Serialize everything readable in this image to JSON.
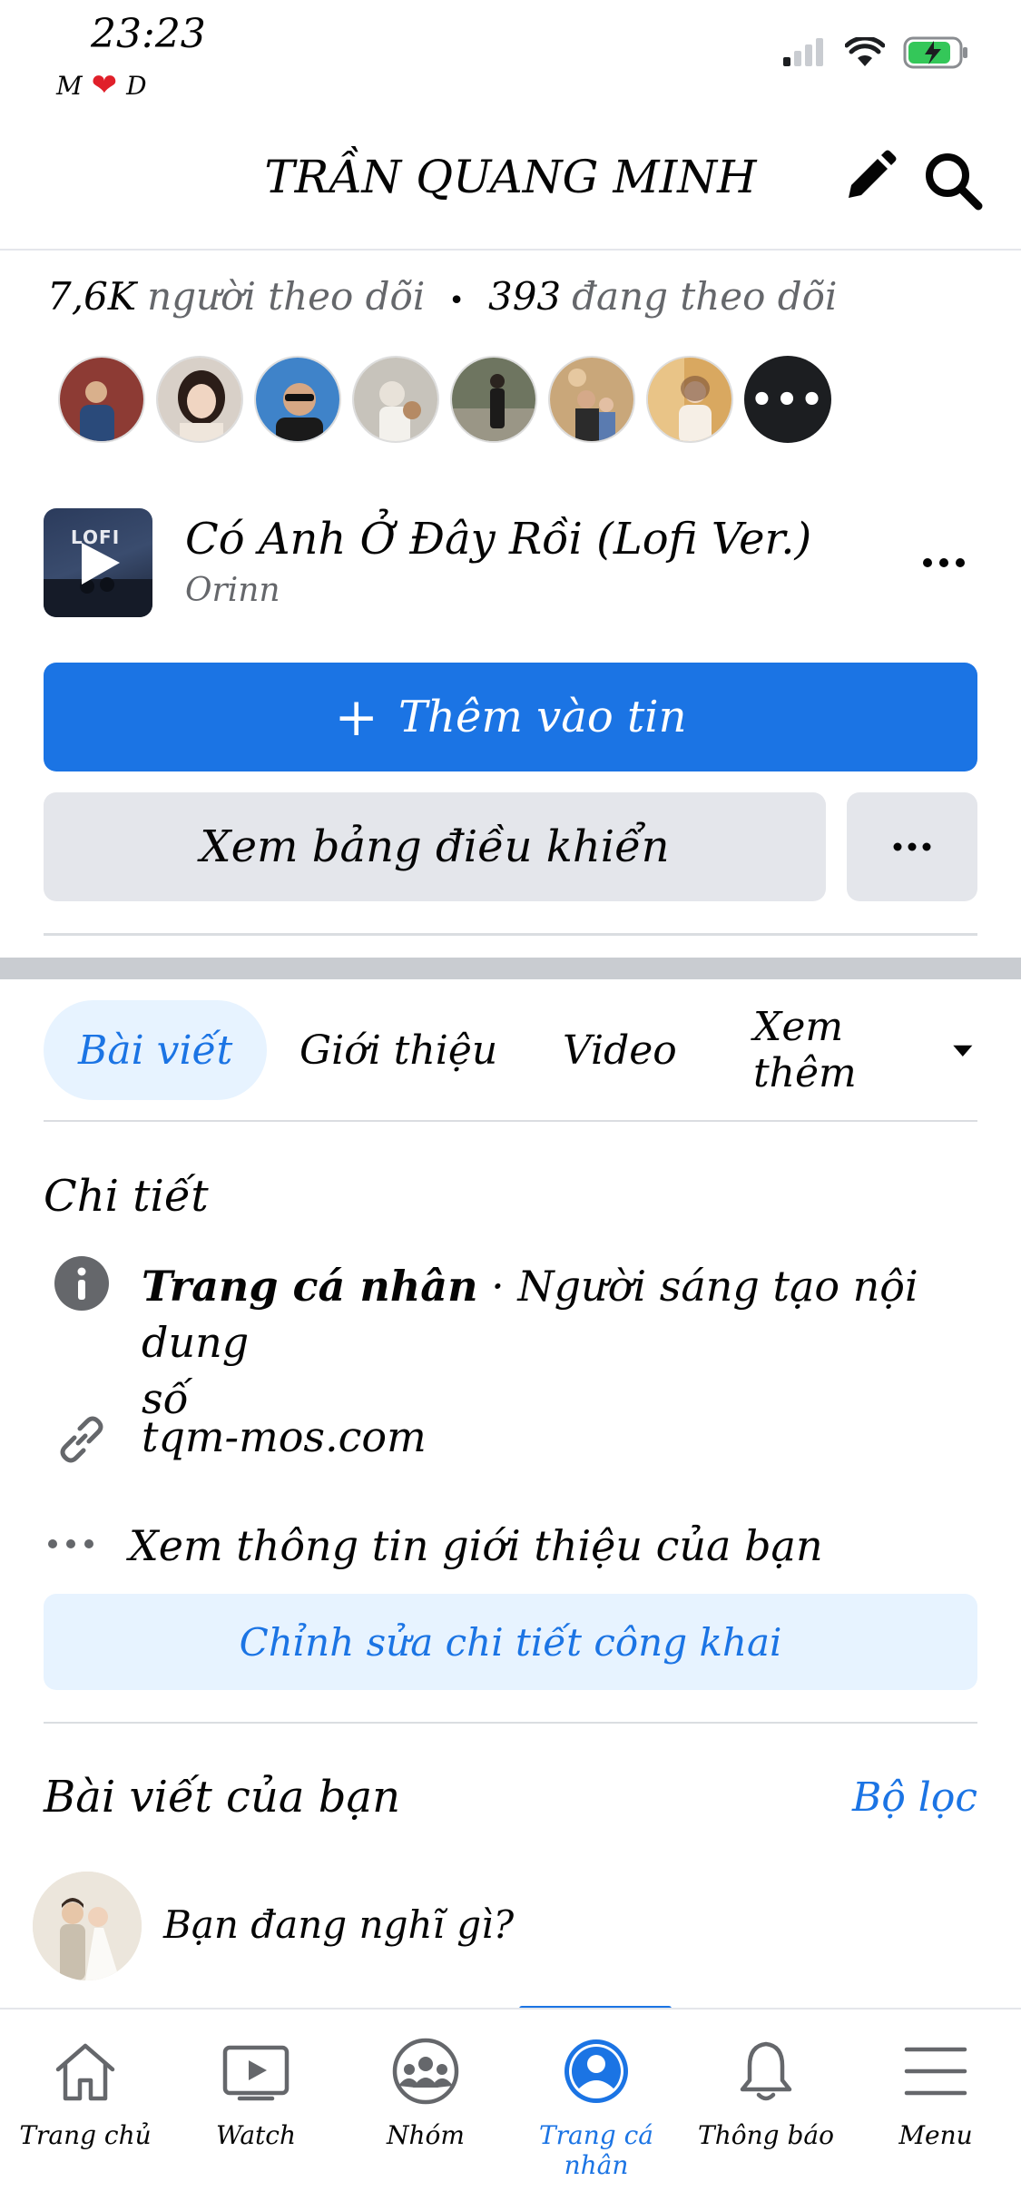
{
  "status_bar": {
    "time": "23:23",
    "sub_left": "M",
    "sub_right": "D"
  },
  "header": {
    "title": "TRẦN QUANG MINH"
  },
  "follow": {
    "followers_count": "7,6K",
    "followers_label": "người theo dõi",
    "following_count": "393",
    "following_label": "đang theo dõi"
  },
  "music": {
    "thumb_text": "LOFI",
    "title": "Có Anh Ở Đây Rồi (Lofi Ver.)",
    "artist": "Orinn"
  },
  "buttons": {
    "add_story": "Thêm vào tin",
    "dashboard": "Xem bảng điều khiển"
  },
  "tabs": [
    {
      "label": "Bài viết",
      "active": true
    },
    {
      "label": "Giới thiệu",
      "active": false
    },
    {
      "label": "Video",
      "active": false
    },
    {
      "label": "Xem thêm",
      "active": false
    }
  ],
  "details": {
    "section_title": "Chi tiết",
    "profile_type_bold": "Trang cá nhân",
    "profile_type_rest": " · Người sáng tạo nội dung",
    "profile_type_rest_line2": "số",
    "website": "tqm-mos.com",
    "see_about": "Xem thông tin giới thiệu của bạn",
    "edit_public": "Chỉnh sửa chi tiết công khai"
  },
  "posts": {
    "section_title": "Bài viết của bạn",
    "filter": "Bộ lọc",
    "composer_placeholder": "Bạn đang nghĩ gì?"
  },
  "bottom_nav": [
    {
      "label": "Trang chủ",
      "icon": "home-icon",
      "active": false
    },
    {
      "label": "Watch",
      "icon": "watch-icon",
      "active": false
    },
    {
      "label": "Nhóm",
      "icon": "groups-icon",
      "active": false
    },
    {
      "label": "Trang cá nhân",
      "icon": "profile-icon",
      "active": true
    },
    {
      "label": "Thông báo",
      "icon": "bell-icon",
      "active": false
    },
    {
      "label": "Menu",
      "icon": "menu-icon",
      "active": false
    }
  ],
  "colors": {
    "accent": "#1b74e4",
    "accent_light": "#e7f3ff",
    "muted": "#65676b",
    "button_grey": "#e4e6eb"
  }
}
